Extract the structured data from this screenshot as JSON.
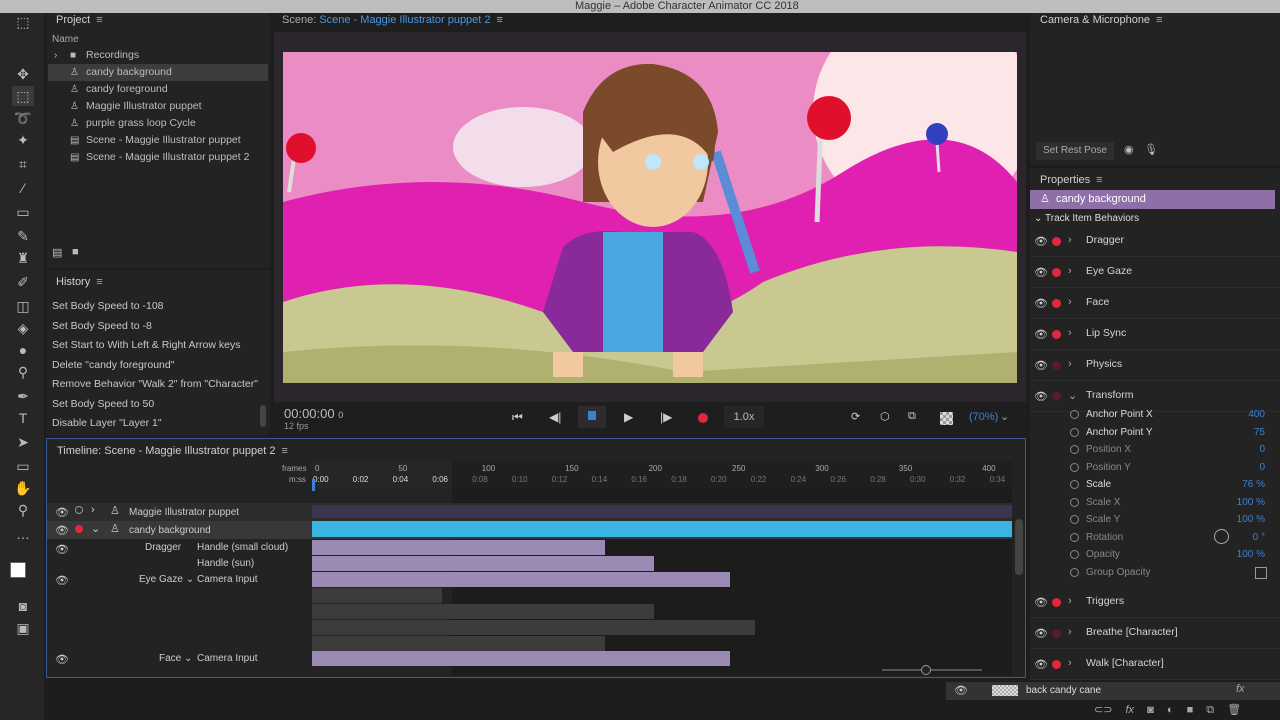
{
  "window": {
    "title": "Maggie – Adobe Character Animator CC 2018"
  },
  "project": {
    "title": "Project",
    "column": "Name",
    "items": [
      {
        "label": "Recordings",
        "icon": "folder-icon"
      },
      {
        "label": "candy background",
        "icon": "puppet-icon",
        "selected": true
      },
      {
        "label": "candy foreground",
        "icon": "puppet-icon"
      },
      {
        "label": "Maggie Illustrator puppet",
        "icon": "puppet-icon"
      },
      {
        "label": "purple grass loop Cycle",
        "icon": "puppet-icon"
      },
      {
        "label": "Scene - Maggie Illustrator puppet",
        "icon": "scene-icon"
      },
      {
        "label": "Scene - Maggie Illustrator puppet 2",
        "icon": "scene-icon"
      }
    ]
  },
  "history": {
    "title": "History",
    "items": [
      "Set Body Speed to -108",
      "Set Body Speed to -8",
      "Set Start to With Left & Right Arrow keys",
      "Delete \"candy foreground\"",
      "Remove Behavior \"Walk 2\" from \"Character\"",
      "Set Body Speed to 50",
      "Disable Layer \"Layer 1\""
    ]
  },
  "scene": {
    "label": "Scene:",
    "name": "Scene - Maggie Illustrator puppet 2",
    "timecode": "00:00:00",
    "frame": "0",
    "fps": "12 fps",
    "speed": "1.0x",
    "zoom": "(70%)"
  },
  "camera": {
    "title": "Camera & Microphone",
    "rest_pose": "Set Rest Pose"
  },
  "properties": {
    "title": "Properties",
    "selected": "candy background",
    "section": "Track Item Behaviors",
    "behaviors_top": [
      {
        "label": "Dragger",
        "armed": true
      },
      {
        "label": "Eye Gaze",
        "armed": true
      },
      {
        "label": "Face",
        "armed": true
      },
      {
        "label": "Lip Sync",
        "armed": true
      },
      {
        "label": "Physics",
        "armed": false
      },
      {
        "label": "Transform",
        "armed": false
      }
    ],
    "transform": [
      {
        "label": "Anchor Point X",
        "value": "400"
      },
      {
        "label": "Anchor Point Y",
        "value": "75"
      },
      {
        "label": "Position X",
        "value": "0"
      },
      {
        "label": "Position Y",
        "value": "0"
      },
      {
        "label": "Scale",
        "value": "76 %"
      },
      {
        "label": "Scale X",
        "value": "100 %"
      },
      {
        "label": "Scale Y",
        "value": "100 %"
      },
      {
        "label": "Rotation",
        "value": "0 °"
      },
      {
        "label": "Opacity",
        "value": "100 %"
      },
      {
        "label": "Group Opacity",
        "value": ""
      }
    ],
    "behaviors_bottom": [
      {
        "label": "Triggers",
        "armed": true
      },
      {
        "label": "Breathe [Character]",
        "armed": false
      },
      {
        "label": "Walk [Character]",
        "armed": true
      }
    ]
  },
  "timeline": {
    "title": "Timeline: Scene - Maggie Illustrator puppet 2",
    "frames_label": "frames",
    "time_label": "m:ss",
    "frame_ticks": [
      "0",
      "50",
      "100",
      "150",
      "200",
      "250",
      "300",
      "350",
      "400"
    ],
    "time_ticks": [
      "0:00",
      "0:02",
      "0:04",
      "0:06",
      "0:08",
      "0:10",
      "0:12",
      "0:14",
      "0:16",
      "0:18",
      "0:20",
      "0:22",
      "0:24",
      "0:26",
      "0:28",
      "0:30",
      "0:32",
      "0:34"
    ],
    "tracks": [
      "Maggie Illustrator puppet",
      "candy background"
    ],
    "params": [
      {
        "behavior": "Dragger",
        "param": "Handle (small cloud)"
      },
      {
        "behavior": "",
        "param": "Handle (sun)"
      },
      {
        "behavior": "Eye Gaze",
        "param": "Camera Input"
      },
      {
        "behavior": "Face",
        "param": "Camera Input"
      }
    ]
  },
  "layers": {
    "row": "back candy cane",
    "fx": "fx"
  },
  "colors": {
    "accent": "#3b82d6",
    "record": "#e0283c",
    "selection": "#8e6fa8",
    "track": "#3ab4e0"
  }
}
